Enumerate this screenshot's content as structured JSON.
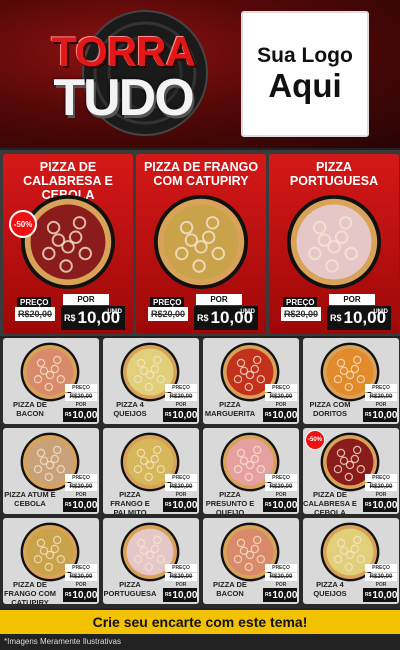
{
  "brand": {
    "line1": "TORRA",
    "line2": "TUDO"
  },
  "logo": {
    "line1": "Sua Logo",
    "line2": "Aqui"
  },
  "labels": {
    "preco": "PREÇO",
    "por": "POR",
    "old_price": "R$20,00",
    "currency": "R$",
    "unit": "UNID"
  },
  "featured": [
    {
      "title": "PIZZA DE CALABRESA E CEBOLA",
      "price": "10,00",
      "badge": "-50%",
      "topping": "#8a1c1c"
    },
    {
      "title": "PIZZA DE FRANGO COM CATUPIRY",
      "price": "10,00",
      "badge": "",
      "topping": "#c9a24a"
    },
    {
      "title": "PIZZA PORTUGUESA",
      "price": "10,00",
      "badge": "",
      "topping": "#e6c7c7"
    }
  ],
  "grid": [
    {
      "name": "PIZZA DE BACON",
      "price": "10,00",
      "badge": "",
      "topping": "#d98a6a"
    },
    {
      "name": "PIZZA 4 QUEIJOS",
      "price": "10,00",
      "badge": "",
      "topping": "#e2cf7a"
    },
    {
      "name": "PIZZA MARGUERITA",
      "price": "10,00",
      "badge": "",
      "topping": "#c3301b"
    },
    {
      "name": "PIZZA COM DORITOS",
      "price": "10,00",
      "badge": "",
      "topping": "#e38a2b"
    },
    {
      "name": "PIZZA ATUM E CEBOLA",
      "price": "10,00",
      "badge": "",
      "topping": "#c9a27a"
    },
    {
      "name": "PIZZA FRANGO E PALMITO",
      "price": "10,00",
      "badge": "",
      "topping": "#d6b75a"
    },
    {
      "name": "PIZZA PRESUNTO E QUEIJO",
      "price": "10,00",
      "badge": "",
      "topping": "#e7a0a0"
    },
    {
      "name": "PIZZA DE CALABRESA E CEBOLA",
      "price": "10,00",
      "badge": "-50%",
      "topping": "#8a1c1c"
    },
    {
      "name": "PIZZA DE FRANGO COM CATUPIRY",
      "price": "10,00",
      "badge": "",
      "topping": "#c9a24a"
    },
    {
      "name": "PIZZA PORTUGUESA",
      "price": "10,00",
      "badge": "",
      "topping": "#e6c7c7"
    },
    {
      "name": "PIZZA DE BACON",
      "price": "10,00",
      "badge": "",
      "topping": "#d98a6a"
    },
    {
      "name": "PIZZA 4 QUEIJOS",
      "price": "10,00",
      "badge": "",
      "topping": "#e2cf7a"
    }
  ],
  "cta": "Crie seu encarte com este tema!",
  "footer": "*Imagens Meramente Ilustrativas",
  "colors": {
    "red": "#d51818",
    "yellow": "#f2c200",
    "dark": "#111111"
  }
}
